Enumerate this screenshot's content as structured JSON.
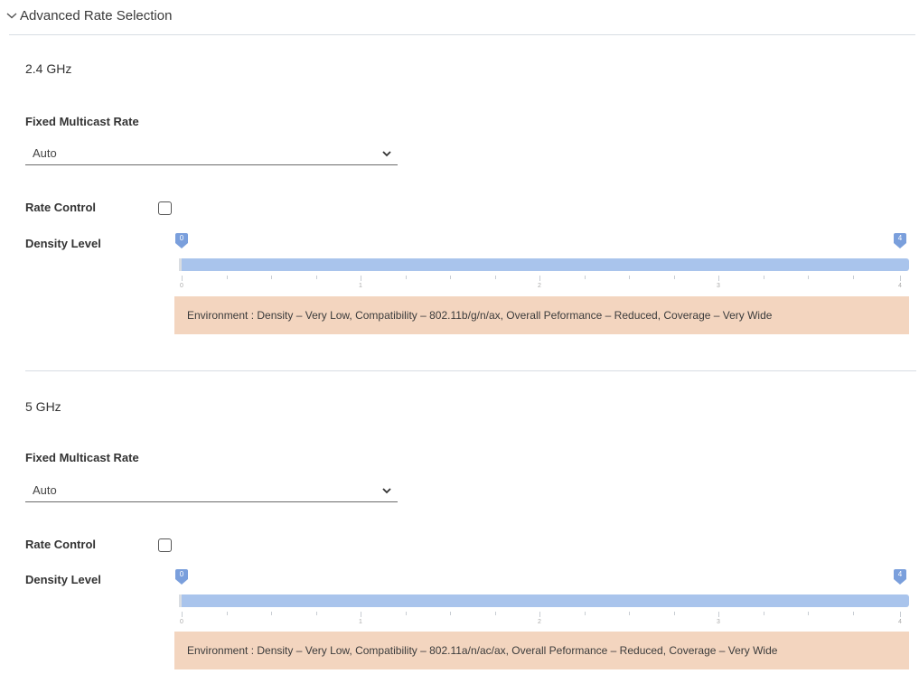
{
  "header": {
    "icon": "chevron-down-icon",
    "title": "Advanced Rate Selection"
  },
  "bands": [
    {
      "title": "2.4 GHz",
      "multicast_label": "Fixed Multicast Rate",
      "multicast_value": "Auto",
      "rate_control_label": "Rate Control",
      "rate_control_checked": false,
      "density_label": "Density Level",
      "slider": {
        "min": 0,
        "max": 4,
        "min_label": "0",
        "max_label": "4",
        "ticks": [
          "0",
          "1",
          "2",
          "3",
          "4"
        ]
      },
      "environment": "Environment : Density – Very Low, Compatibility – 802.11b/g/n/ax, Overall Peformance – Reduced, Coverage – Very Wide"
    },
    {
      "title": "5 GHz",
      "multicast_label": "Fixed Multicast Rate",
      "multicast_value": "Auto",
      "rate_control_label": "Rate Control",
      "rate_control_checked": false,
      "density_label": "Density Level",
      "slider": {
        "min": 0,
        "max": 4,
        "min_label": "0",
        "max_label": "4",
        "ticks": [
          "0",
          "1",
          "2",
          "3",
          "4"
        ]
      },
      "environment": "Environment : Density – Very Low, Compatibility – 802.11a/n/ac/ax, Overall Peformance – Reduced, Coverage – Very Wide"
    }
  ],
  "colors": {
    "slider_track": "#a9c4ec",
    "slider_handle": "#7a9fdc",
    "environment_bg": "#f3d5bf",
    "divider": "#d8dde3"
  }
}
